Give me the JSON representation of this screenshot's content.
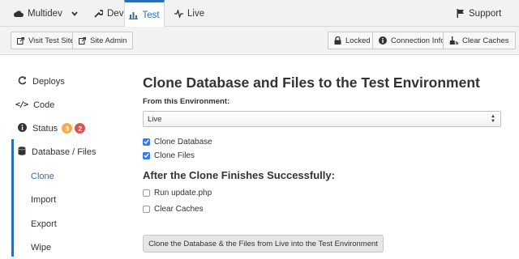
{
  "env_tabs": [
    {
      "label": "Multidev",
      "icon": "cloud-icon"
    },
    {
      "label": "Dev",
      "icon": "wrench-icon"
    },
    {
      "label": "Test",
      "icon": "bar-chart-icon",
      "active": true
    },
    {
      "label": "Live",
      "icon": "pulse-icon"
    }
  ],
  "support": {
    "label": "Support",
    "icon": "flag-icon"
  },
  "toolbar": {
    "visit_test_site": "Visit Test Site",
    "site_admin": "Site Admin",
    "locked": "Locked",
    "connection_info": "Connection Info",
    "clear_caches": "Clear Caches"
  },
  "sidebar": {
    "items": [
      {
        "label": "Deploys",
        "icon": "refresh-icon"
      },
      {
        "label": "Code",
        "icon": "code-icon"
      },
      {
        "label": "Status",
        "icon": "info-icon",
        "badges": [
          {
            "value": "3",
            "color": "#f0ad4e"
          },
          {
            "value": "2",
            "color": "#d9534f"
          }
        ]
      },
      {
        "label": "Database / Files",
        "icon": "database-icon"
      },
      {
        "label": "Clone",
        "current": true
      },
      {
        "label": "Import"
      },
      {
        "label": "Export"
      },
      {
        "label": "Wipe"
      }
    ]
  },
  "main": {
    "title": "Clone Database and Files to the Test Environment",
    "from_label": "From this Environment:",
    "from_value": "Live",
    "clone_database": {
      "label": "Clone Database",
      "checked": true
    },
    "clone_files": {
      "label": "Clone Files",
      "checked": true
    },
    "after_heading": "After the Clone Finishes Successfully:",
    "run_update": {
      "label": "Run update.php",
      "checked": false
    },
    "clear_caches": {
      "label": "Clear Caches",
      "checked": false
    },
    "submit_label": "Clone the Database & the Files from Live into the Test Environment"
  },
  "colors": {
    "accent": "#2c6fb3",
    "checkbox": "#3478f6"
  }
}
